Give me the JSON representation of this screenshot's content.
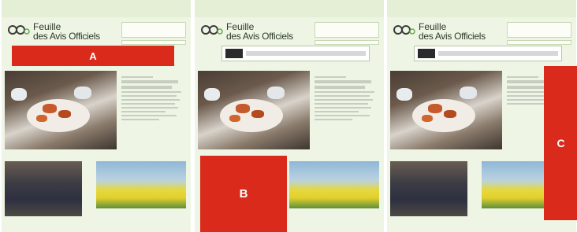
{
  "site": {
    "brand_line1": "Feuille",
    "brand_line2": "des Avis Officiels"
  },
  "labels": {
    "A": "A",
    "B": "B",
    "C": "C"
  },
  "colors": {
    "label_red": "#d92a1c",
    "page_green": "#eef5e4"
  }
}
